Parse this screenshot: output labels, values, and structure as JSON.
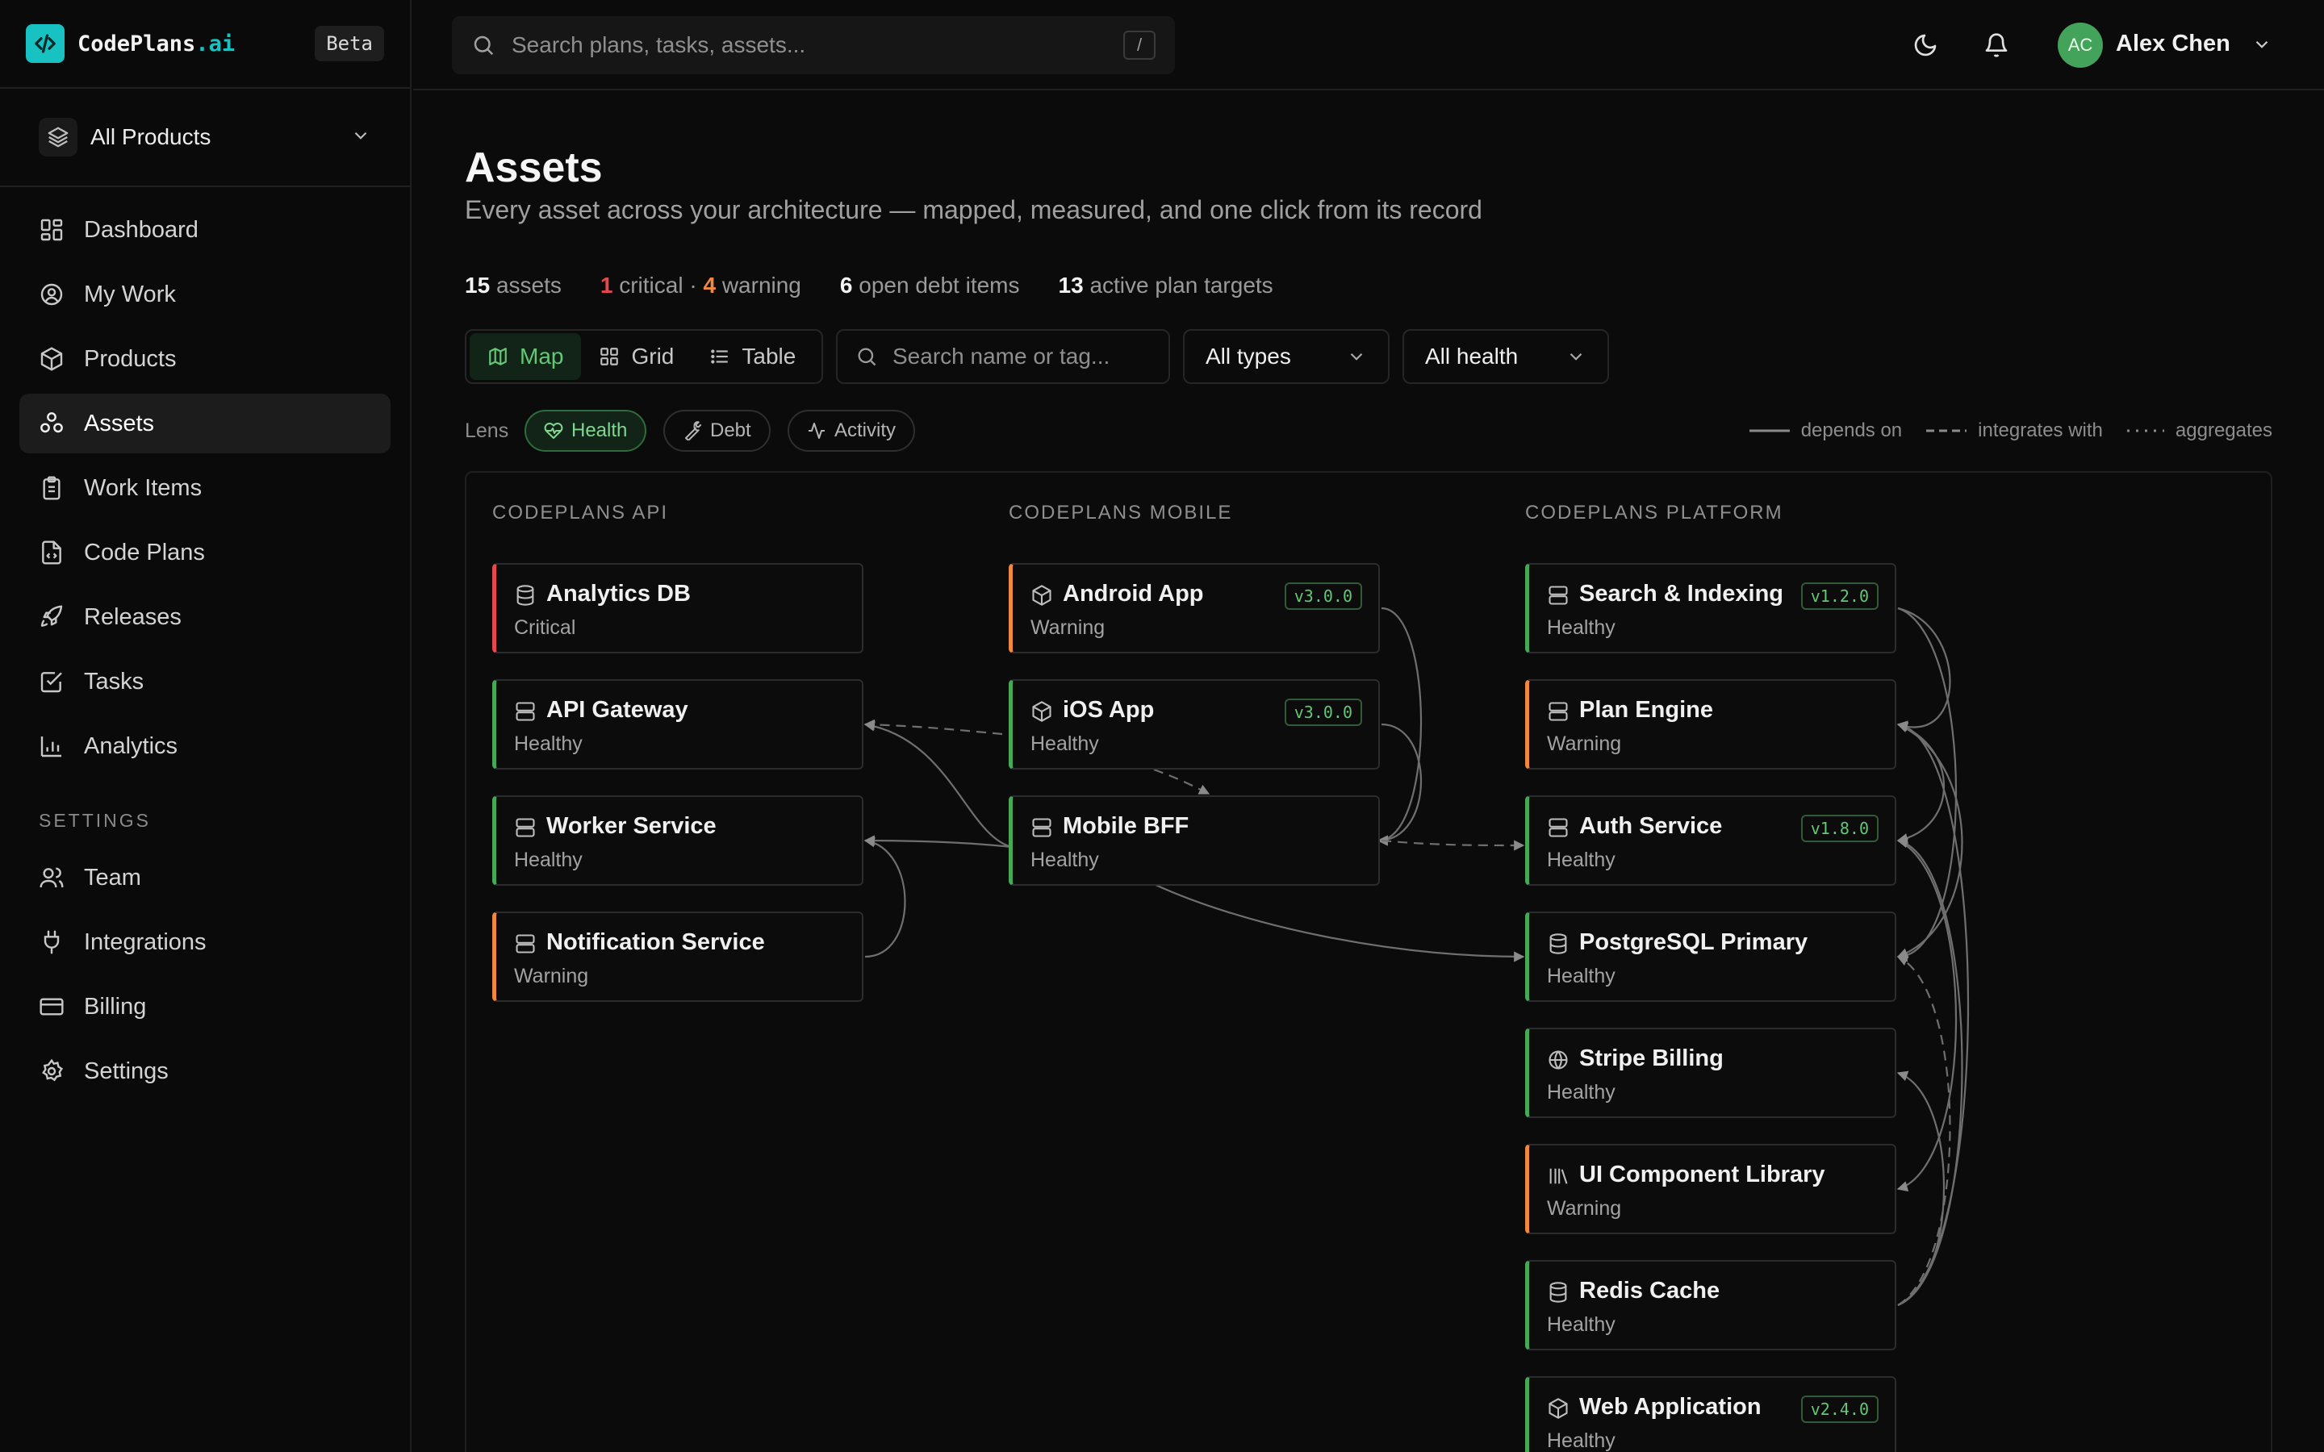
{
  "brand": {
    "name": "CodePlans",
    "suffix": ".ai",
    "badge": "Beta"
  },
  "product_switcher": {
    "label": "All Products"
  },
  "nav": {
    "items": [
      {
        "label": "Dashboard",
        "icon": "dashboard-icon"
      },
      {
        "label": "My Work",
        "icon": "user-circle-icon"
      },
      {
        "label": "Products",
        "icon": "package-icon"
      },
      {
        "label": "Assets",
        "icon": "assets-icon",
        "active": true
      },
      {
        "label": "Work Items",
        "icon": "clipboard-icon"
      },
      {
        "label": "Code Plans",
        "icon": "file-code-icon"
      },
      {
        "label": "Releases",
        "icon": "rocket-icon"
      },
      {
        "label": "Tasks",
        "icon": "check-square-icon"
      },
      {
        "label": "Analytics",
        "icon": "bar-chart-icon"
      }
    ],
    "settings_heading": "SETTINGS",
    "settings_items": [
      {
        "label": "Team",
        "icon": "users-icon"
      },
      {
        "label": "Integrations",
        "icon": "plug-icon"
      },
      {
        "label": "Billing",
        "icon": "credit-card-icon"
      },
      {
        "label": "Settings",
        "icon": "gear-icon"
      }
    ]
  },
  "topbar": {
    "search_placeholder": "Search plans, tasks, assets...",
    "search_shortcut": "/",
    "user": {
      "initials": "AC",
      "name": "Alex Chen"
    }
  },
  "page": {
    "title": "Assets",
    "subtitle": "Every asset across your architecture — mapped, measured, and one click from its record"
  },
  "stats": {
    "assets_count": "15",
    "assets_label": "assets",
    "critical_count": "1",
    "critical_label": "critical ·",
    "warning_count": "4",
    "warning_label": "warning",
    "debt_count": "6",
    "debt_label": "open debt items",
    "targets_count": "13",
    "targets_label": "active plan targets"
  },
  "toolbar": {
    "views": [
      "Map",
      "Grid",
      "Table"
    ],
    "active_view": "Map",
    "search_placeholder": "Search name or tag...",
    "type_filter": "All types",
    "health_filter": "All health"
  },
  "lens": {
    "label": "Lens",
    "options": [
      "Health",
      "Debt",
      "Activity"
    ],
    "active": "Health"
  },
  "legend": {
    "depends_on": "depends on",
    "integrates_with": "integrates with",
    "aggregates": "aggregates"
  },
  "colors": {
    "healthy": "#46a758",
    "warning": "#f0883e",
    "critical": "#e5484d",
    "brand": "#19c2c2"
  },
  "map": {
    "columns": [
      {
        "title": "CODEPLANS API",
        "assets": [
          {
            "name": "Analytics DB",
            "status": "Critical",
            "icon": "database-icon"
          },
          {
            "name": "API Gateway",
            "status": "Healthy",
            "icon": "server-icon"
          },
          {
            "name": "Worker Service",
            "status": "Healthy",
            "icon": "server-icon"
          },
          {
            "name": "Notification Service",
            "status": "Warning",
            "icon": "server-icon"
          }
        ]
      },
      {
        "title": "CODEPLANS MOBILE",
        "assets": [
          {
            "name": "Android App",
            "status": "Warning",
            "icon": "box-icon",
            "version": "v3.0.0"
          },
          {
            "name": "iOS App",
            "status": "Healthy",
            "icon": "box-icon",
            "version": "v3.0.0"
          },
          {
            "name": "Mobile BFF",
            "status": "Healthy",
            "icon": "server-icon"
          }
        ]
      },
      {
        "title": "CODEPLANS PLATFORM",
        "assets": [
          {
            "name": "Search & Indexing",
            "status": "Healthy",
            "icon": "server-icon",
            "version": "v1.2.0"
          },
          {
            "name": "Plan Engine",
            "status": "Warning",
            "icon": "server-icon"
          },
          {
            "name": "Auth Service",
            "status": "Healthy",
            "icon": "server-icon",
            "version": "v1.8.0"
          },
          {
            "name": "PostgreSQL Primary",
            "status": "Healthy",
            "icon": "database-icon"
          },
          {
            "name": "Stripe Billing",
            "status": "Healthy",
            "icon": "globe-icon"
          },
          {
            "name": "UI Component Library",
            "status": "Warning",
            "icon": "library-icon"
          },
          {
            "name": "Redis Cache",
            "status": "Healthy",
            "icon": "database-icon"
          },
          {
            "name": "Web Application",
            "status": "Healthy",
            "icon": "box-icon",
            "version": "v2.4.0"
          }
        ]
      }
    ],
    "edges": [
      {
        "from": "Mobile BFF",
        "to": "API Gateway",
        "kind": "depends on"
      },
      {
        "from": "Mobile BFF",
        "to": "Worker Service",
        "kind": "depends on"
      },
      {
        "from": "Notification Service",
        "to": "Worker Service",
        "kind": "depends on"
      },
      {
        "from": "iOS App",
        "to": "API Gateway",
        "kind": "integrates with"
      },
      {
        "from": "iOS App",
        "to": "Mobile BFF",
        "kind": "integrates with"
      },
      {
        "from": "Android App",
        "to": "Mobile BFF",
        "kind": "depends on"
      },
      {
        "from": "iOS App",
        "to": "Mobile BFF",
        "kind": "depends on"
      },
      {
        "from": "Mobile BFF",
        "to": "Auth Service",
        "kind": "integrates with"
      },
      {
        "from": "Mobile BFF",
        "to": "PostgreSQL Primary",
        "kind": "depends on"
      },
      {
        "from": "Search & Indexing",
        "to": "Plan Engine",
        "kind": "depends on"
      },
      {
        "from": "Search & Indexing",
        "to": "PostgreSQL Primary",
        "kind": "depends on"
      },
      {
        "from": "Plan Engine",
        "to": "Auth Service",
        "kind": "depends on"
      },
      {
        "from": "Plan Engine",
        "to": "PostgreSQL Primary",
        "kind": "depends on"
      },
      {
        "from": "Auth Service",
        "to": "Redis Cache",
        "kind": "depends on"
      },
      {
        "from": "Web Application",
        "to": "Stripe Billing",
        "kind": "integrates with"
      },
      {
        "from": "Web Application",
        "to": "UI Component Library",
        "kind": "depends on"
      },
      {
        "from": "Web Application",
        "to": "Auth Service",
        "kind": "depends on"
      },
      {
        "from": "Web Application",
        "to": "Plan Engine",
        "kind": "depends on"
      }
    ]
  }
}
